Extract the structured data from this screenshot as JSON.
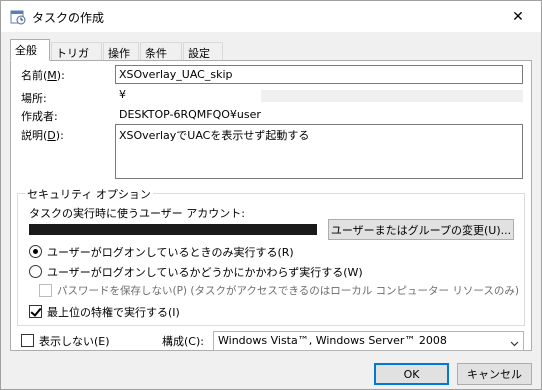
{
  "window": {
    "title": "タスクの作成",
    "close_glyph": "✕"
  },
  "tabs": [
    {
      "label": "全般",
      "active": true
    },
    {
      "label": "トリガー",
      "active": false
    },
    {
      "label": "操作",
      "active": false
    },
    {
      "label": "条件",
      "active": false
    },
    {
      "label": "設定",
      "active": false
    }
  ],
  "general": {
    "name_label": "名前(",
    "name_key": "M",
    "name_suffix": "):",
    "name_value": "XSOverlay_UAC_skip",
    "location_label": "場所:",
    "location_value": "¥",
    "author_label": "作成者:",
    "author_value": "DESKTOP-6RQMFQO¥user",
    "desc_label": "説明(",
    "desc_key": "D",
    "desc_suffix": "):",
    "desc_value": "XSOverlayでUACを表示せず起動する"
  },
  "security": {
    "group_title": "セキュリティ オプション",
    "account_label": "タスクの実行時に使うユーザー アカウント:",
    "change_user_button": "ユーザーまたはグループの変更(U)...",
    "radio_logged_on": "ユーザーがログオンしているときのみ実行する(R)",
    "radio_logged_on_checked": true,
    "radio_whether": "ユーザーがログオンしているかどうかにかかわらず実行する(W)",
    "radio_whether_checked": false,
    "no_store_password": "パスワードを保存しない(P) (タスクがアクセスできるのはローカル コンピューター リソースのみ)",
    "no_store_password_checked": false,
    "highest_privileges": "最上位の特権で実行する(I)",
    "highest_privileges_checked": true
  },
  "bottom": {
    "hidden_label": "表示しない(E)",
    "hidden_checked": false,
    "configure_label": "構成(C):",
    "configure_value": "Windows Vista™, Windows Server™ 2008"
  },
  "buttons": {
    "ok": "OK",
    "cancel": "キャンセル"
  }
}
